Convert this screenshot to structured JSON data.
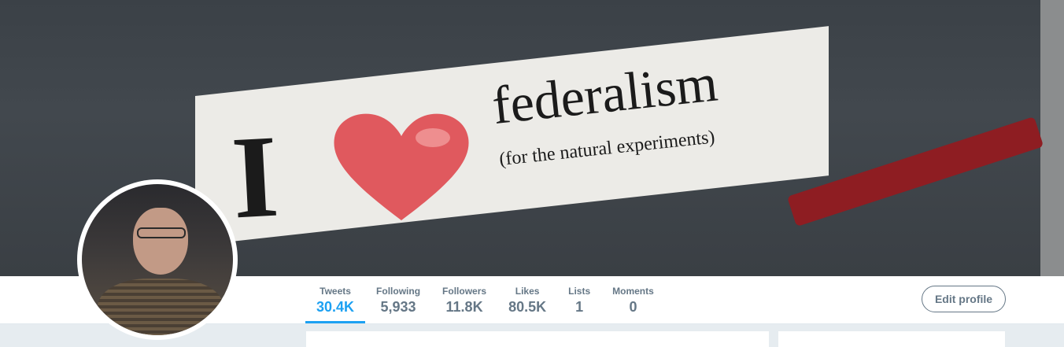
{
  "banner": {
    "sticker_i": "I",
    "sticker_word": "federalism",
    "sticker_sub": "(for the natural experiments)",
    "heart_color": "#e0595e"
  },
  "stats": [
    {
      "label": "Tweets",
      "value": "30.4K",
      "active": true
    },
    {
      "label": "Following",
      "value": "5,933",
      "active": false
    },
    {
      "label": "Followers",
      "value": "11.8K",
      "active": false
    },
    {
      "label": "Likes",
      "value": "80.5K",
      "active": false
    },
    {
      "label": "Lists",
      "value": "1",
      "active": false
    },
    {
      "label": "Moments",
      "value": "0",
      "active": false
    }
  ],
  "edit_profile_label": "Edit profile",
  "colors": {
    "accent": "#1da1f2",
    "muted": "#657786",
    "background": "#e6ecf0"
  }
}
